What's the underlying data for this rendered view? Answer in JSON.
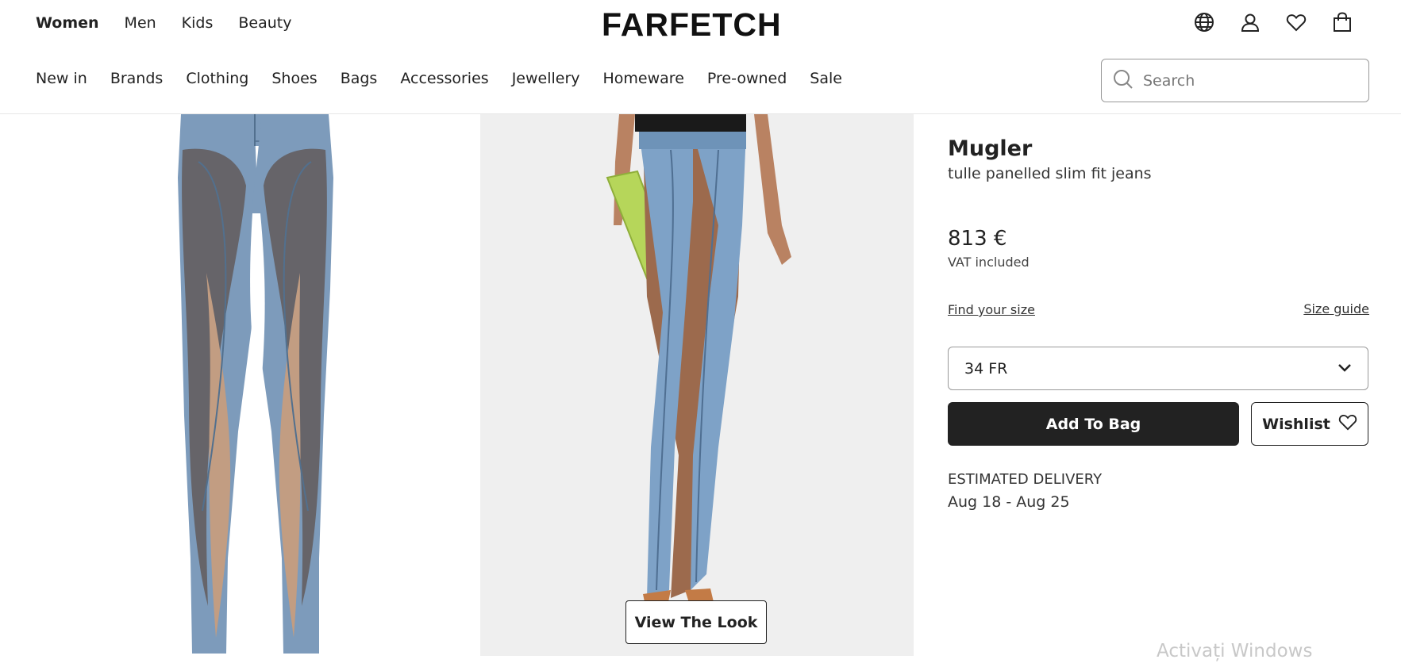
{
  "header": {
    "departments": [
      "Women",
      "Men",
      "Kids",
      "Beauty"
    ],
    "active_department": "Women",
    "logo": "FARFETCH",
    "icons": [
      "globe-icon",
      "account-icon",
      "heart-icon",
      "bag-icon"
    ]
  },
  "categories": [
    "New in",
    "Brands",
    "Clothing",
    "Shoes",
    "Bags",
    "Accessories",
    "Jewellery",
    "Homeware",
    "Pre-owned",
    "Sale"
  ],
  "search": {
    "placeholder": "Search",
    "value": ""
  },
  "gallery": {
    "view_look_label": "View The Look"
  },
  "product": {
    "brand": "Mugler",
    "name": "tulle panelled slim fit jeans",
    "price": "813 €",
    "vat": "VAT included",
    "find_size": "Find your size",
    "size_guide": "Size guide",
    "selected_size": "34 FR",
    "add_to_bag": "Add To Bag",
    "wishlist": "Wishlist",
    "delivery_label": "ESTIMATED DELIVERY",
    "delivery_dates": "Aug 18 - Aug 25"
  },
  "watermark": "Activați Windows",
  "colors": {
    "primary": "#222222",
    "denim": "#7d9bbb",
    "sheer": "#b78f73",
    "bag_green": "#b6d65a"
  }
}
